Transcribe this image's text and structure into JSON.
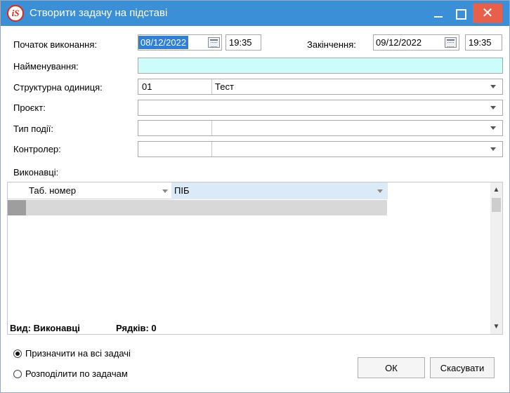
{
  "window": {
    "app_icon_text": "iS",
    "title": "Створити задачу на підставі"
  },
  "form": {
    "start_label": "Початок виконання:",
    "start_date": "08/12/2022",
    "start_time": "19:35",
    "end_label": "Закінчення:",
    "end_date": "09/12/2022",
    "end_time": "19:35",
    "name_label": "Найменування:",
    "name_value": "",
    "unit_label": "Структурна одиниця:",
    "unit_code": "01",
    "unit_name": "Тест",
    "project_label": "Проєкт:",
    "project_value": "",
    "event_type_label": "Тип події:",
    "controller_label": "Контролер:"
  },
  "executors": {
    "label": "Виконавці:",
    "columns": [
      "Таб. номер",
      "ПІБ"
    ],
    "status_view": "Вид: Виконавці",
    "status_rows": "Рядків: 0"
  },
  "options": {
    "assign_all_label": "Призначити на всі задачі",
    "distribute_label": "Розподілити по задачам",
    "selected": "assign_all"
  },
  "buttons": {
    "ok": "ОК",
    "cancel": "Скасувати"
  },
  "colors": {
    "titlebar": "#3b8fd6",
    "close_button": "#e8604c",
    "name_field": "#cdfdfa",
    "date_selection": "#2f7fd6"
  }
}
